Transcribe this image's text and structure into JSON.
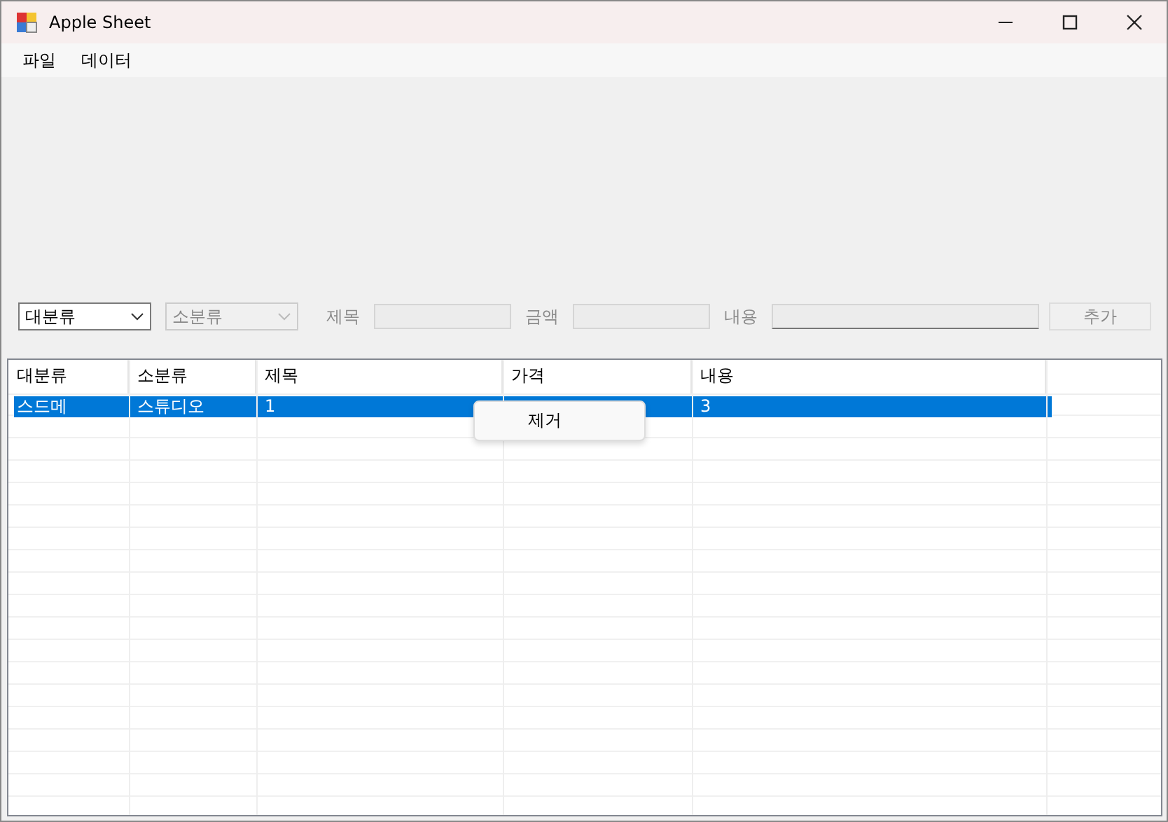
{
  "window": {
    "title": "Apple Sheet"
  },
  "menu": [
    {
      "label": "파일"
    },
    {
      "label": "데이터"
    }
  ],
  "filters": [
    {
      "value": "대분류",
      "disabled": false
    },
    {
      "value": "소분류",
      "disabled": true
    }
  ],
  "fields": [
    {
      "label": "제목",
      "disabled": true
    },
    {
      "label": "금액",
      "disabled": true
    },
    {
      "label": "내용",
      "disabled": true
    }
  ],
  "add_button": {
    "label": "추가",
    "disabled": true
  },
  "table": {
    "columns": [
      "대분류",
      "소분류",
      "제목",
      "가격",
      "내용"
    ],
    "rows": [
      {
        "cells": [
          "스드메",
          "스튜디오",
          "1",
          null,
          "3"
        ],
        "selected": true
      }
    ]
  },
  "context_menu": {
    "items": [
      {
        "label": "제거"
      }
    ]
  }
}
